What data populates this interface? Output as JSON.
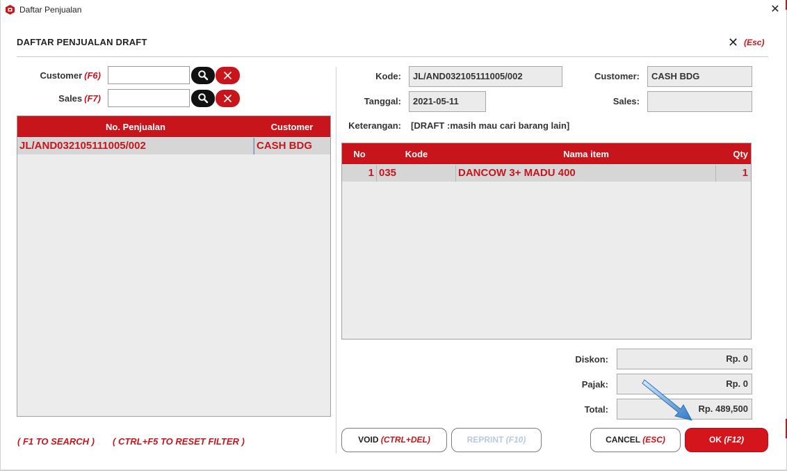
{
  "window": {
    "title": "Daftar Penjualan",
    "close_glyph": "✕"
  },
  "header": {
    "title": "DAFTAR PENJUALAN DRAFT",
    "close_glyph": "✕",
    "close_hotkey": "(Esc)"
  },
  "filters": {
    "customer_label": "Customer",
    "customer_hotkey": "(F6)",
    "customer_value": "",
    "sales_label": "Sales",
    "sales_hotkey": "(F7)",
    "sales_value": "",
    "search_icon": "search-icon",
    "clear_icon": "close-icon"
  },
  "sales_list": {
    "columns": [
      "No. Penjualan",
      "Customer"
    ],
    "rows": [
      {
        "no_penjualan": "JL/AND032105111005/002",
        "customer": "CASH BDG",
        "selected": true
      }
    ]
  },
  "detail": {
    "kode_label": "Kode:",
    "kode_value": "JL/AND032105111005/002",
    "customer_label": "Customer:",
    "customer_value": "CASH BDG",
    "tanggal_label": "Tanggal:",
    "tanggal_value": "2021-05-11",
    "sales_label": "Sales:",
    "sales_value": "",
    "keterangan_label": "Keterangan:",
    "keterangan_value": "[DRAFT :masih mau cari barang lain]"
  },
  "items": {
    "columns": [
      "No",
      "Kode",
      "Nama item",
      "Qty"
    ],
    "rows": [
      {
        "no": "1",
        "kode": "035",
        "nama": "DANCOW 3+ MADU 400",
        "qty": "1"
      }
    ]
  },
  "summary": {
    "diskon_label": "Diskon:",
    "diskon_value": "Rp. 0",
    "pajak_label": "Pajak:",
    "pajak_value": "Rp. 0",
    "total_label": "Total:",
    "total_value": "Rp. 489,500"
  },
  "hints": {
    "search": "( F1 TO SEARCH )",
    "reset": "( CTRL+F5 TO RESET FILTER )"
  },
  "buttons": {
    "void_label": "VOID",
    "void_hotkey": "(CTRL+DEL)",
    "reprint_label": "REPRINT",
    "reprint_hotkey": "(F10)",
    "cancel_label": "CANCEL",
    "cancel_hotkey": "(ESC)",
    "ok_label": "OK",
    "ok_hotkey": "(F12)"
  },
  "colors": {
    "brand_red": "#c8151c",
    "panel_bg": "#ececec",
    "disabled_text": "#b6cbe0",
    "annotation_arrow": "#4a8fd0"
  }
}
